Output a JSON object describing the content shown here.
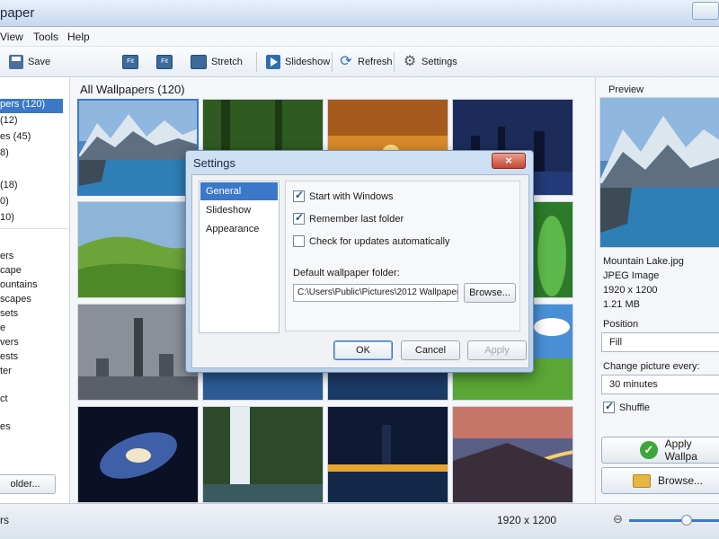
{
  "app": {
    "title": "paper"
  },
  "menu": [
    "View",
    "Tools",
    "Help"
  ],
  "toolbar": {
    "save": "Save",
    "fit1": "Fit",
    "fit2": "Fit",
    "stretch": "Stretch",
    "slideshow": "Slideshow",
    "refresh": "Refresh",
    "settings": "Settings"
  },
  "sidebar": {
    "items": [
      "pers (120)",
      "(12)",
      "es (45)",
      "8)",
      "",
      "(18)",
      "0)",
      "10)"
    ],
    "categories": [
      "ers",
      "cape",
      "ountains",
      "scapes",
      "sets",
      "e",
      "vers",
      "ests",
      "ter",
      "ct",
      "es"
    ],
    "folder_button": "older..."
  },
  "main": {
    "heading": "All Wallpapers (120)"
  },
  "right": {
    "preview_label": "Preview",
    "filename": "Mountain Lake.jpg",
    "filetype": "JPEG Image",
    "dimensions": "1920 x 1200",
    "filesize": "1.21 MB",
    "position_label": "Position",
    "position_value": "Fill",
    "change_label": "Change picture every:",
    "change_value": "30 minutes",
    "shuffle_label": "Shuffle",
    "apply_button": "Apply Wallpa",
    "browse_button": "Browse..."
  },
  "status": {
    "left": "rs",
    "resolution": "1920 x 1200",
    "zoom_fraction": 0.64
  },
  "dialog": {
    "title": "Settings",
    "nav": [
      "General",
      "Slideshow",
      "Appearance"
    ],
    "options": {
      "start_with_windows": "Start with Windows",
      "remember_last_folder": "Remember last folder",
      "check_updates": "Check for updates automatically"
    },
    "folder_label": "Default wallpaper folder:",
    "folder_path": "C:\\Users\\Public\\Pictures\\2012 Wallpaper",
    "browse": "Browse...",
    "ok": "OK",
    "cancel": "Cancel",
    "apply": "Apply",
    "close_glyph": "×"
  },
  "colors": {
    "accent": "#3b78c9"
  },
  "icons": [
    "save-icon",
    "fit-icon",
    "stretch-icon",
    "slideshow-icon",
    "refresh-icon",
    "gear-icon",
    "zoom-out-icon",
    "check-icon",
    "folder-icon"
  ]
}
